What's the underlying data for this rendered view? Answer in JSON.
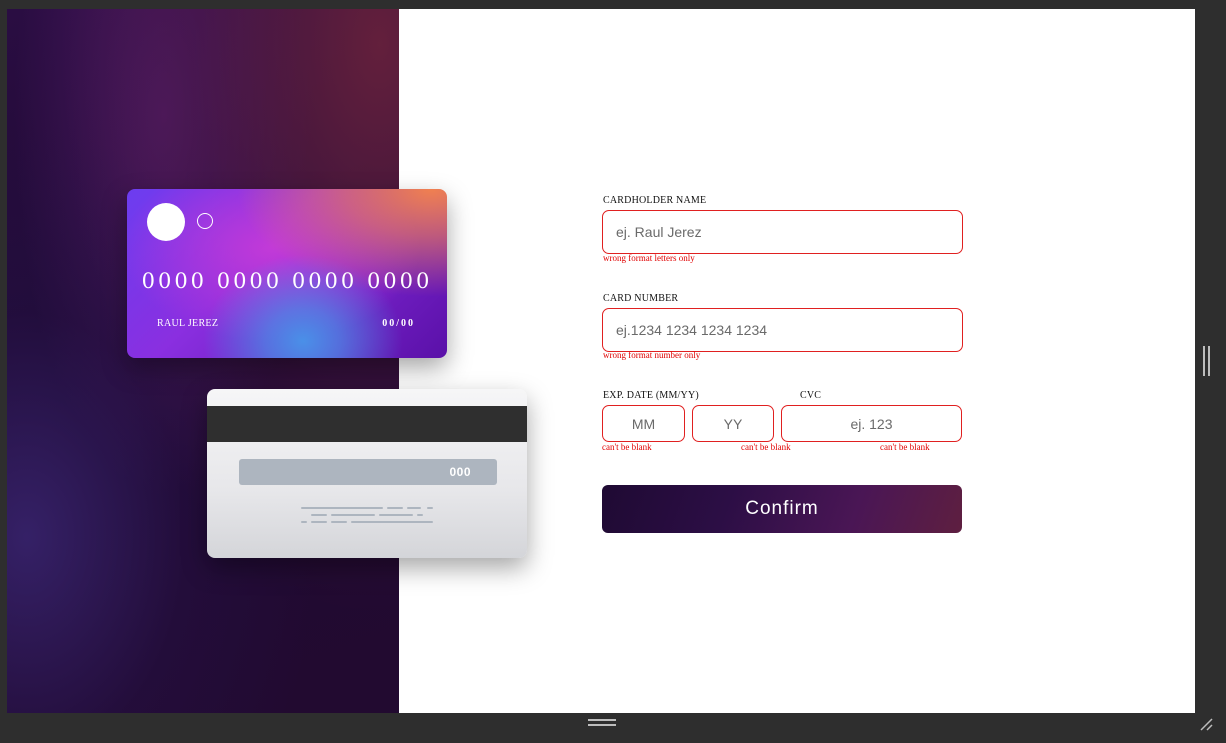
{
  "card_front": {
    "number": "0000 0000 0000 0000",
    "holder": "RAUL JEREZ",
    "expiry": "00/00"
  },
  "card_back": {
    "cvc": "000"
  },
  "form": {
    "cardholder": {
      "label": "CARDHOLDER NAME",
      "placeholder": "ej. Raul Jerez",
      "value": "",
      "error": "wrong format letters only"
    },
    "card_number": {
      "label": "CARD NUMBER",
      "placeholder": "ej.1234 1234 1234 1234",
      "value": "",
      "error": "wrong format number only"
    },
    "exp": {
      "label": "EXP. DATE (MM/YY)",
      "month_placeholder": "MM",
      "year_placeholder": "YY",
      "month_error": "can't be blank",
      "year_error": "can't be blank"
    },
    "cvc": {
      "label": "CVC",
      "placeholder": "ej. 123",
      "error": "can't be blank"
    },
    "confirm_label": "Confirm"
  },
  "colors": {
    "error": "#e00000",
    "panel_dark": "#1f0a33",
    "accent": "#5e1f40"
  }
}
